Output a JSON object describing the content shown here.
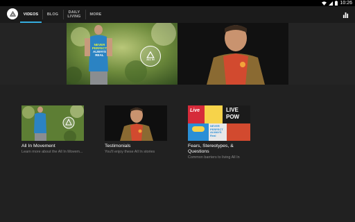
{
  "status": {
    "time": "10:26"
  },
  "appbar": {
    "tabs": [
      {
        "label": "VIDEOS",
        "active": true
      },
      {
        "label": "BLOG",
        "active": false
      },
      {
        "label": "DAILY LIVING",
        "active": false
      },
      {
        "label": "MORE",
        "active": false
      }
    ]
  },
  "hero": {
    "shirt_text_1": "NEVER",
    "shirt_text_2": "PERFECT",
    "shirt_text_3": "ALWAYS",
    "shirt_text_4": "REAL",
    "badge_text": "ALL IN"
  },
  "cards": [
    {
      "title": "All In Movement",
      "subtitle": "Learn more about the All In Movem..."
    },
    {
      "title": "Testimonials",
      "subtitle": "You'll enjoy these All In stories"
    },
    {
      "title": "Fears, Stereotypes, & Questions",
      "subtitle": "Common barriers to living All In"
    }
  ],
  "collage": {
    "t1": "Live",
    "t2": "LIVE",
    "t3": "POW",
    "t4": "NEVER PERFECT ALWAYS Real"
  },
  "colors": {
    "accent": "#35aee0",
    "background": "#212121",
    "appbar": "#1b1b1b"
  }
}
